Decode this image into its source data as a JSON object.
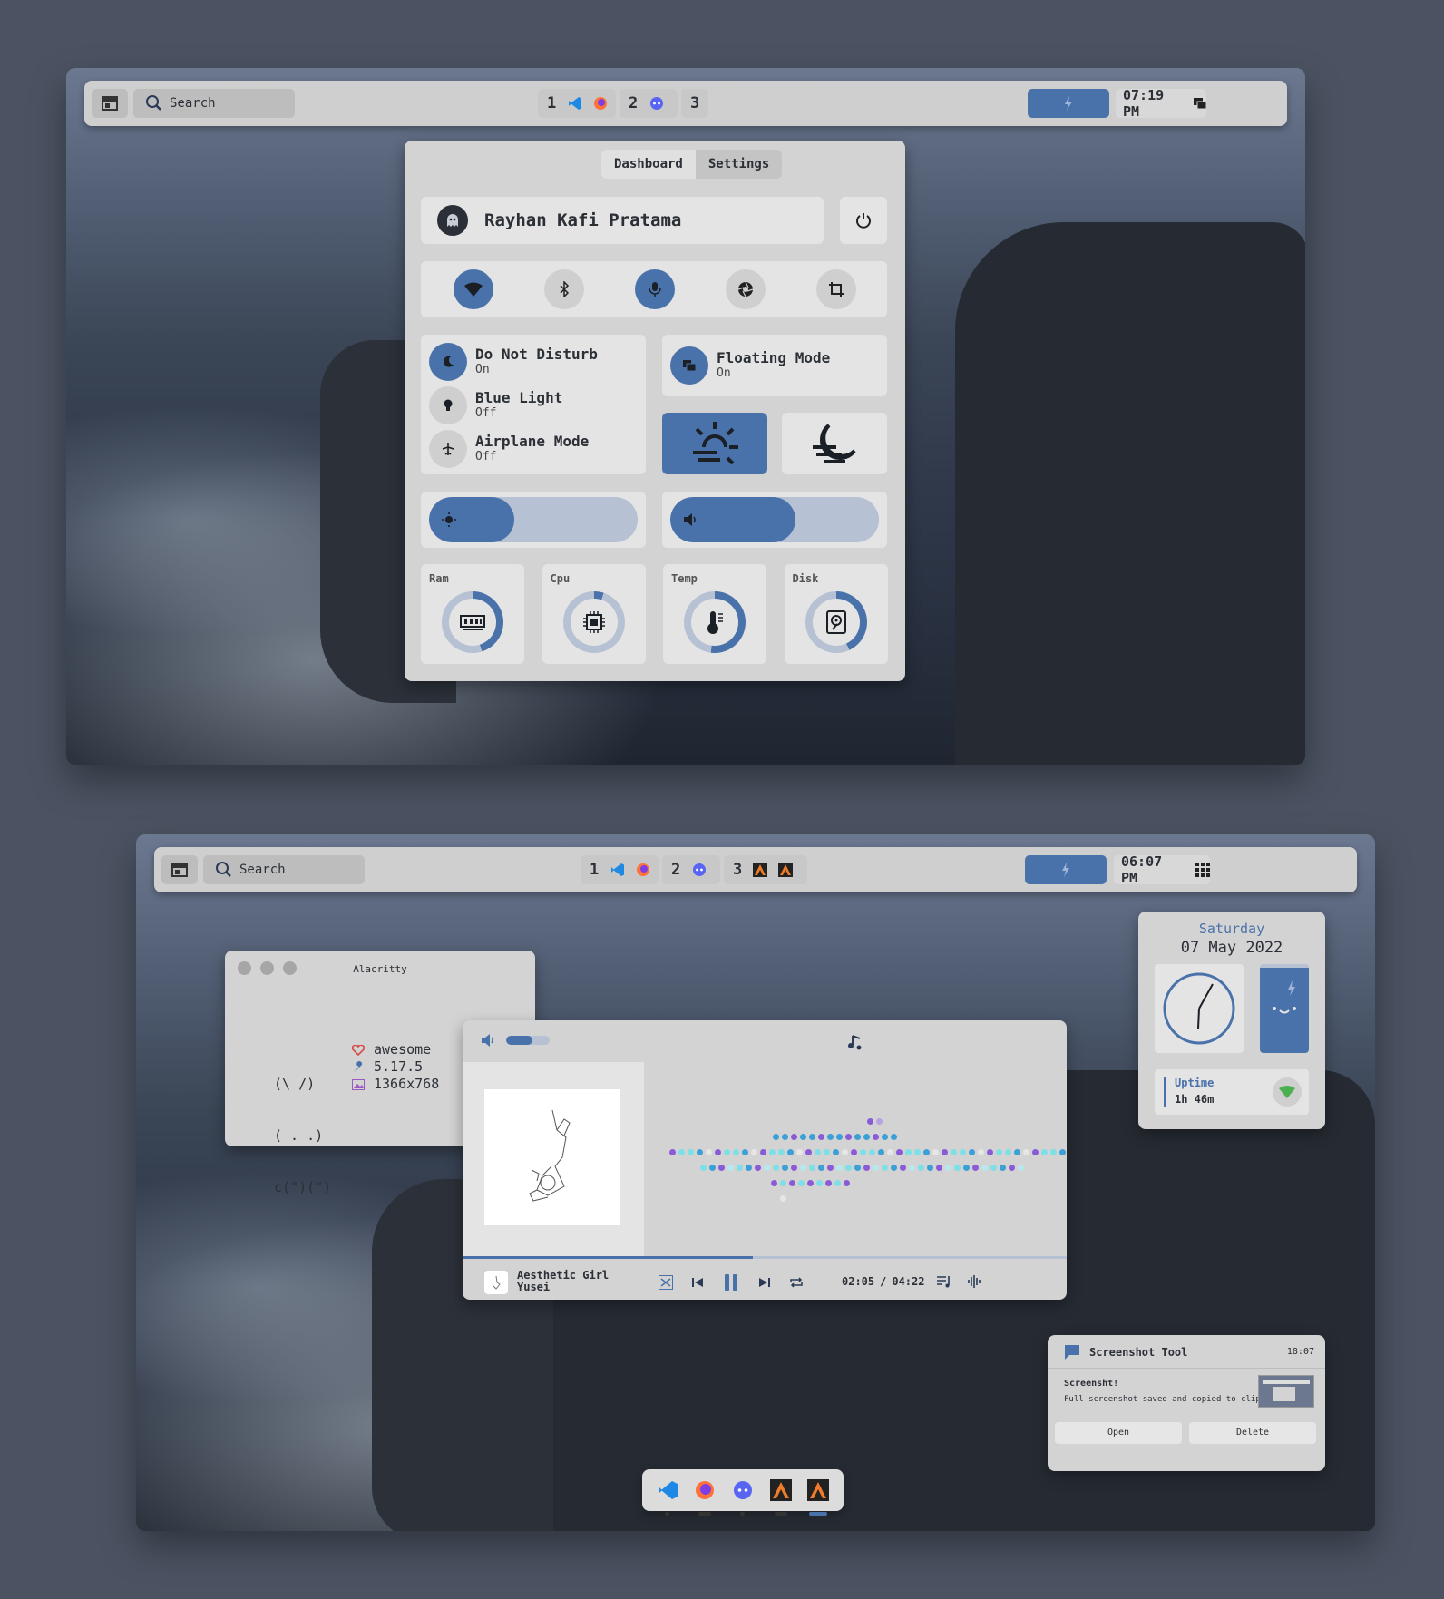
{
  "top_screen": {
    "taskbar": {
      "search_placeholder": "Search",
      "workspaces": [
        {
          "num": "1"
        },
        {
          "num": "2"
        },
        {
          "num": "3"
        }
      ],
      "clock": "07:19 PM"
    },
    "dashboard": {
      "tabs": [
        "Dashboard",
        "Settings"
      ],
      "active_tab": "Dashboard",
      "user_name": "Rayhan Kafi Pratama",
      "quick_toggles": [
        {
          "icon": "wifi-icon",
          "active": true
        },
        {
          "icon": "bluetooth-icon",
          "active": false
        },
        {
          "icon": "microphone-icon",
          "active": true
        },
        {
          "icon": "camera-shutter-icon",
          "active": false
        },
        {
          "icon": "crop-icon",
          "active": false
        }
      ],
      "modes": [
        {
          "title": "Do Not Disturb",
          "state": "On",
          "icon": "moon-icon",
          "active": true
        },
        {
          "title": "Blue Light",
          "state": "Off",
          "icon": "bulb-icon",
          "active": false
        },
        {
          "title": "Airplane Mode",
          "state": "Off",
          "icon": "airplane-icon",
          "active": false
        }
      ],
      "floating_mode": {
        "title": "Floating Mode",
        "state": "On"
      },
      "theme_buttons": [
        {
          "icon": "sun-icon",
          "active": true
        },
        {
          "icon": "moon-haze-icon",
          "active": false
        }
      ],
      "brightness_level": 0.41,
      "volume_level": 0.6,
      "monitors": [
        {
          "label": "Ram",
          "icon": "ram-icon",
          "level": 0.45
        },
        {
          "label": "Cpu",
          "icon": "cpu-icon",
          "level": 0.05
        },
        {
          "label": "Temp",
          "icon": "thermometer-icon",
          "level": 0.52
        },
        {
          "label": "Disk",
          "icon": "disk-icon",
          "level": 0.43
        }
      ]
    }
  },
  "bottom_screen": {
    "taskbar": {
      "search_placeholder": "Search",
      "workspaces": [
        {
          "num": "1"
        },
        {
          "num": "2"
        },
        {
          "num": "3"
        }
      ],
      "clock": "06:07 PM"
    },
    "terminal": {
      "title": "Alacritty",
      "ascii": [
        "(\\ /)",
        "( . .)",
        "c(\")(\")"
      ],
      "info": [
        {
          "icon": "heart-icon",
          "text": "awesome"
        },
        {
          "icon": "wrench-icon",
          "text": "5.17.5"
        },
        {
          "icon": "image-icon",
          "text": "1366x768"
        }
      ]
    },
    "music": {
      "volume_level": 0.6,
      "track_title": "Aesthetic Girl",
      "artist": "Yusei",
      "elapsed": "02:05",
      "separator": "/",
      "duration": "04:22",
      "progress": 0.48
    },
    "calendar_widget": {
      "day": "Saturday",
      "date": "07 May 2022",
      "uptime_label": "Uptime",
      "uptime_value": "1h 46m"
    },
    "notification": {
      "app": "Screenshot Tool",
      "time": "18:07",
      "title": "Screensht!",
      "body": "Full screenshot saved and copied to clipbo",
      "actions": [
        "Open",
        "Delete"
      ]
    },
    "dock": [
      {
        "icon": "vscode-icon",
        "indicator": "dot"
      },
      {
        "icon": "firefox-icon",
        "indicator": "bar"
      },
      {
        "icon": "discord-icon",
        "indicator": "dot"
      },
      {
        "icon": "alacritty-icon",
        "indicator": "bar"
      },
      {
        "icon": "alacritty-icon",
        "indicator": "active"
      }
    ]
  },
  "colors": {
    "accent": "#4a72aa",
    "panel": "#d3d3d3",
    "card": "#e4e4e4",
    "background": "#4b5362"
  }
}
